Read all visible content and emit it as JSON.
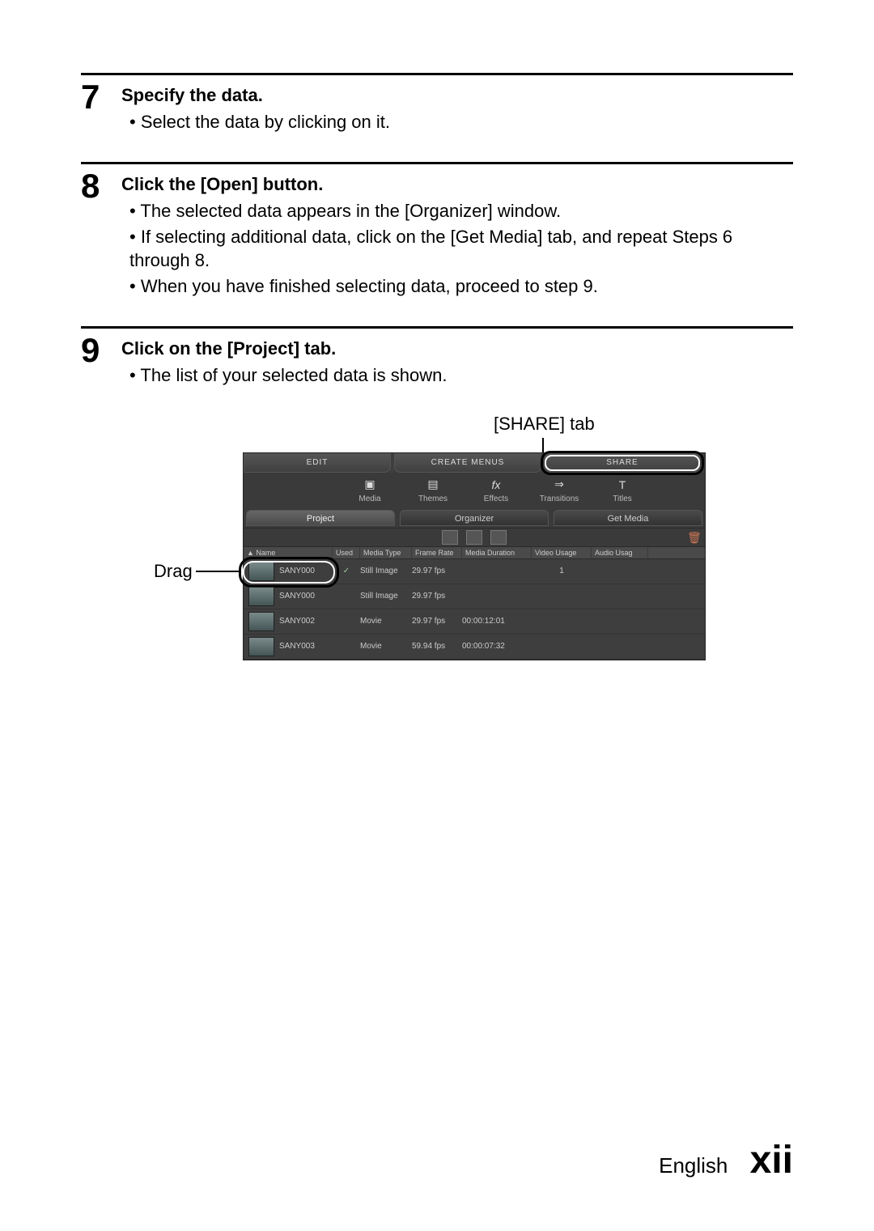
{
  "steps": [
    {
      "num": "7",
      "title": "Specify the data.",
      "items": [
        "Select the data by clicking on it."
      ]
    },
    {
      "num": "8",
      "title": "Click the [Open] button.",
      "items": [
        "The selected data appears in the [Organizer] window.",
        "If selecting additional data, click on the [Get Media] tab, and repeat Steps 6 through 8.",
        "When you have finished selecting data, proceed to step 9."
      ]
    },
    {
      "num": "9",
      "title": "Click on the [Project] tab.",
      "items": [
        "The list of your selected data is shown."
      ]
    }
  ],
  "labels": {
    "share_tab": "[SHARE] tab",
    "drag": "Drag"
  },
  "panel": {
    "top_tabs": {
      "edit": "EDIT",
      "create": "CREATE MENUS",
      "share": "SHARE"
    },
    "tools": {
      "media": "Media",
      "themes": "Themes",
      "effects": "Effects",
      "transitions": "Transitions",
      "titles": "Titles"
    },
    "mid_tabs": {
      "project": "Project",
      "organizer": "Organizer",
      "get_media": "Get Media"
    },
    "columns": {
      "name": "▲ Name",
      "used": "Used",
      "media_type": "Media Type",
      "frame_rate": "Frame Rate",
      "media_duration": "Media Duration",
      "video_usage": "Video Usage",
      "audio_usage": "Audio Usag"
    },
    "rows": [
      {
        "name": "SANY000",
        "used": "✓",
        "type": "Still Image",
        "rate": "29.97 fps",
        "dur": "",
        "vid": "1"
      },
      {
        "name": "SANY000",
        "used": "",
        "type": "Still Image",
        "rate": "29.97 fps",
        "dur": "",
        "vid": ""
      },
      {
        "name": "SANY002",
        "used": "",
        "type": "Movie",
        "rate": "29.97 fps",
        "dur": "00:00:12:01",
        "vid": ""
      },
      {
        "name": "SANY003",
        "used": "",
        "type": "Movie",
        "rate": "59.94 fps",
        "dur": "00:00:07:32",
        "vid": ""
      }
    ]
  },
  "footer": {
    "lang": "English",
    "page": "xii"
  }
}
